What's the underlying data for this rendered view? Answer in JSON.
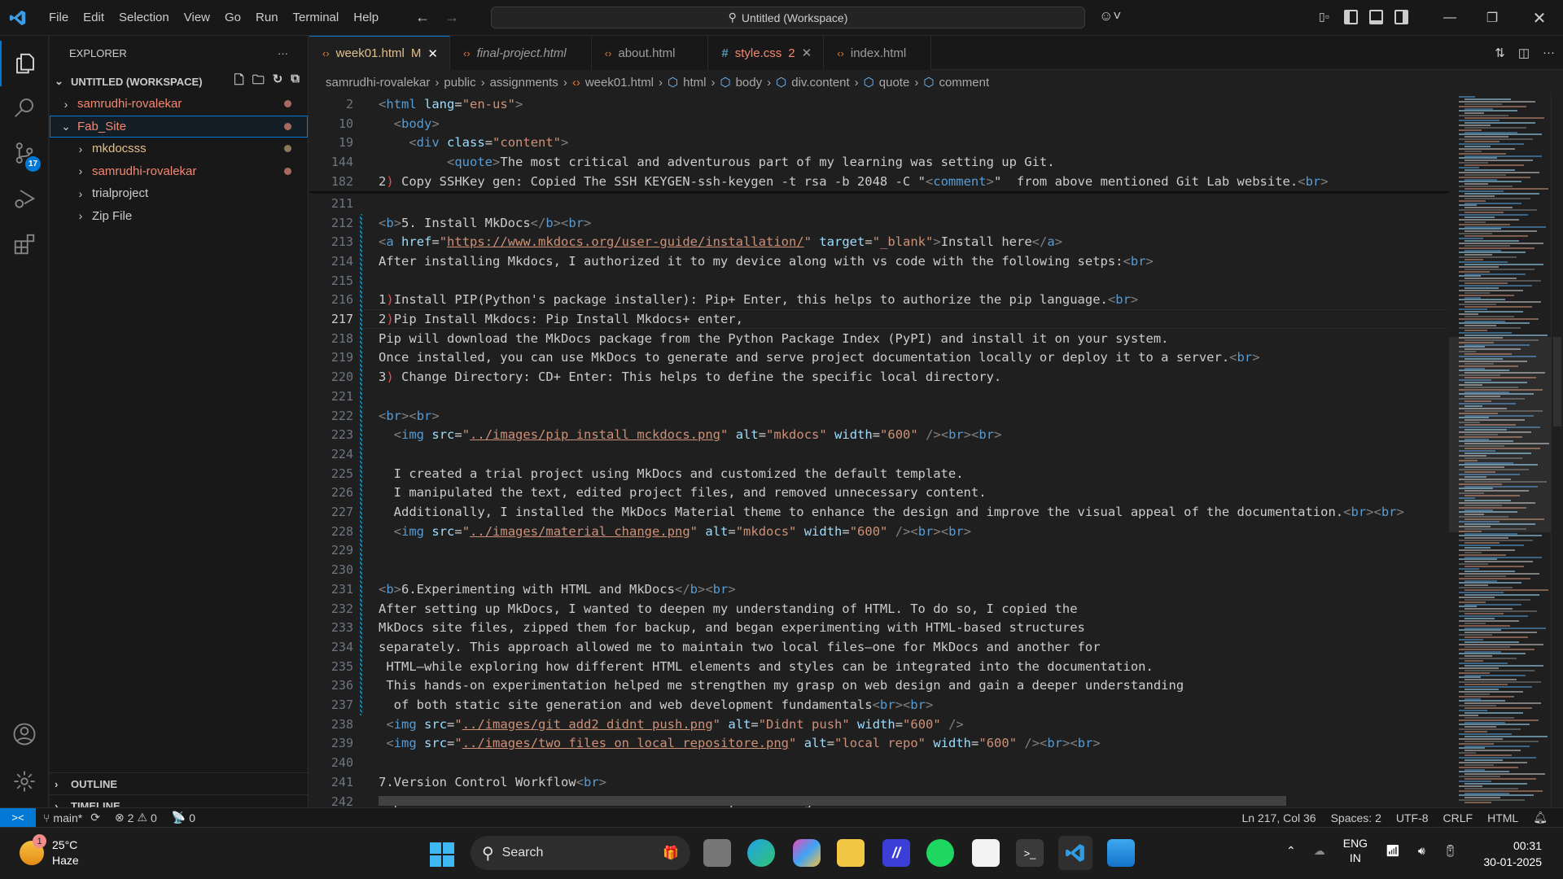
{
  "titlebar": {
    "menu": [
      "File",
      "Edit",
      "Selection",
      "View",
      "Go",
      "Run",
      "Terminal",
      "Help"
    ],
    "command_center": "Untitled (Workspace)",
    "window_controls": [
      "minimize",
      "restore",
      "close"
    ]
  },
  "activity_bar": {
    "items": [
      {
        "name": "explorer",
        "icon": "files-icon",
        "active": true
      },
      {
        "name": "search",
        "icon": "search-icon"
      },
      {
        "name": "source-control",
        "icon": "source-control-icon",
        "badge": "17"
      },
      {
        "name": "run-debug",
        "icon": "debug-icon"
      },
      {
        "name": "extensions",
        "icon": "extensions-icon"
      }
    ],
    "bottom": [
      {
        "name": "accounts",
        "icon": "account-icon"
      },
      {
        "name": "manage",
        "icon": "gear-icon"
      }
    ]
  },
  "sidebar": {
    "title": "EXPLORER",
    "workspace": "UNTITLED (WORKSPACE)",
    "tree": [
      {
        "label": "samrudhi-rovalekar",
        "level": 0,
        "expanded": false,
        "color": "#f48771",
        "dot": "#a8695f"
      },
      {
        "label": "Fab_Site",
        "level": 0,
        "expanded": true,
        "color": "#f48771",
        "dot": "#a8695f",
        "selected": true
      },
      {
        "label": "mkdocsss",
        "level": 1,
        "expanded": false,
        "color": "#e2c08d",
        "dot": "#8a7a5a"
      },
      {
        "label": "samrudhi-rovalekar",
        "level": 1,
        "expanded": false,
        "color": "#f48771",
        "dot": "#a8695f"
      },
      {
        "label": "trialproject",
        "level": 1,
        "expanded": false,
        "color": "#cccccc"
      },
      {
        "label": "Zip File",
        "level": 1,
        "expanded": false,
        "color": "#cccccc"
      }
    ],
    "outline": "OUTLINE",
    "timeline": "TIMELINE"
  },
  "tabs": [
    {
      "label": "week01.html",
      "suffix": "M",
      "icon": "html",
      "active": true,
      "closable": true
    },
    {
      "label": "final-project.html",
      "icon": "html",
      "italic": true
    },
    {
      "label": "about.html",
      "icon": "html"
    },
    {
      "label": "style.css",
      "suffix": "2",
      "icon": "css",
      "closable": true,
      "color": "#f48771"
    },
    {
      "label": "index.html",
      "icon": "html"
    }
  ],
  "breadcrumb": [
    "samrudhi-rovalekar",
    "public",
    "assignments",
    "week01.html",
    "html",
    "body",
    "div.content",
    "quote",
    "comment"
  ],
  "editor": {
    "sticky": [
      {
        "n": "2",
        "html": "<span class='p'>&lt;</span><span class='t'>html</span> <span class='a'>lang</span>=<span class='s'>\"en-us\"</span><span class='p'>&gt;</span>"
      },
      {
        "n": "10",
        "html": "  <span class='p'>&lt;</span><span class='t'>body</span><span class='p'>&gt;</span>"
      },
      {
        "n": "19",
        "html": "    <span class='p'>&lt;</span><span class='t'>div</span> <span class='a'>class</span>=<span class='s'>\"content\"</span><span class='p'>&gt;</span>"
      },
      {
        "n": "144",
        "html": "         <span class='p'>&lt;</span><span class='t'>quote</span><span class='p'>&gt;</span>The most critical and adventurous part of my learning was setting up Git."
      },
      {
        "n": "182",
        "html": "2<span class='r'>)</span> Copy SSHKey gen: Copied The SSH KEYGEN-ssh-keygen -t rsa -b 2048 -C \"<span class='p'>&lt;</span><span class='t'>comment</span><span class='p'>&gt;</span>\"  from above mentioned Git Lab website.<span class='p'>&lt;</span><span class='t'>br</span><span class='p'>&gt;</span>"
      }
    ],
    "lines": [
      {
        "n": "211",
        "html": ""
      },
      {
        "n": "212",
        "html": "<span class='p'>&lt;</span><span class='t'>b</span><span class='p'>&gt;</span>5. Install MkDocs<span class='p'>&lt;/</span><span class='t'>b</span><span class='p'>&gt;&lt;</span><span class='t'>br</span><span class='p'>&gt;</span>"
      },
      {
        "n": "213",
        "html": "<span class='p'>&lt;</span><span class='t'>a</span> <span class='a'>href</span>=<span class='s'>\"</span><span class='u'>https://www.mkdocs.org/user-guide/installation/</span><span class='s'>\"</span> <span class='a'>target</span>=<span class='s'>\"_blank\"</span><span class='p'>&gt;</span>Install here<span class='p'>&lt;/</span><span class='t'>a</span><span class='p'>&gt;</span>"
      },
      {
        "n": "214",
        "html": "After installing Mkdocs, I authorized it to my device along with vs code with the following setps:<span class='p'>&lt;</span><span class='t'>br</span><span class='p'>&gt;</span>"
      },
      {
        "n": "215",
        "html": ""
      },
      {
        "n": "216",
        "html": "1<span class='r'>)</span>Install PIP(Python's package installer): Pip+ Enter, this helps to authorize the pip language.<span class='p'>&lt;</span><span class='t'>br</span><span class='p'>&gt;</span>"
      },
      {
        "n": "217",
        "html": "2<span class='r'>)</span>Pip Install Mkdocs: Pip Install Mkdocs+ enter,",
        "current": true
      },
      {
        "n": "218",
        "html": "Pip will download the MkDocs package from the Python Package Index (PyPI) and install it on your system."
      },
      {
        "n": "219",
        "html": "Once installed, you can use MkDocs to generate and serve project documentation locally or deploy it to a server.<span class='p'>&lt;</span><span class='t'>br</span><span class='p'>&gt;</span>"
      },
      {
        "n": "220",
        "html": "3<span class='r'>)</span> Change Directory: CD+ Enter: This helps to define the specific local directory."
      },
      {
        "n": "221",
        "html": ""
      },
      {
        "n": "222",
        "html": "<span class='p'>&lt;</span><span class='t'>br</span><span class='p'>&gt;&lt;</span><span class='t'>br</span><span class='p'>&gt;</span>"
      },
      {
        "n": "223",
        "html": "  <span class='p'>&lt;</span><span class='t'>img</span> <span class='a'>src</span>=<span class='s'>\"</span><span class='u'>../images/pip install mckdocs.png</span><span class='s'>\"</span> <span class='a'>alt</span>=<span class='s'>\"mkdocs\"</span> <span class='a'>width</span>=<span class='s'>\"600\"</span> <span class='p'>/&gt;&lt;</span><span class='t'>br</span><span class='p'>&gt;&lt;</span><span class='t'>br</span><span class='p'>&gt;</span>"
      },
      {
        "n": "224",
        "html": ""
      },
      {
        "n": "225",
        "html": "  I created a trial project using MkDocs and customized the default template."
      },
      {
        "n": "226",
        "html": "  I manipulated the text, edited project files, and removed unnecessary content."
      },
      {
        "n": "227",
        "html": "  Additionally, I installed the MkDocs Material theme to enhance the design and improve the visual appeal of the documentation.<span class='p'>&lt;</span><span class='t'>br</span><span class='p'>&gt;&lt;</span><span class='t'>br</span><span class='p'>&gt;</span>"
      },
      {
        "n": "228",
        "html": "  <span class='p'>&lt;</span><span class='t'>img</span> <span class='a'>src</span>=<span class='s'>\"</span><span class='u'>../images/material change.png</span><span class='s'>\"</span> <span class='a'>alt</span>=<span class='s'>\"mkdocs\"</span> <span class='a'>width</span>=<span class='s'>\"600\"</span> <span class='p'>/&gt;&lt;</span><span class='t'>br</span><span class='p'>&gt;&lt;</span><span class='t'>br</span><span class='p'>&gt;</span>"
      },
      {
        "n": "229",
        "html": ""
      },
      {
        "n": "230",
        "html": ""
      },
      {
        "n": "231",
        "html": "<span class='p'>&lt;</span><span class='t'>b</span><span class='p'>&gt;</span>6.Experimenting with HTML and MkDocs<span class='p'>&lt;/</span><span class='t'>b</span><span class='p'>&gt;&lt;</span><span class='t'>br</span><span class='p'>&gt;</span>"
      },
      {
        "n": "232",
        "html": "After setting up MkDocs, I wanted to deepen my understanding of HTML. To do so, I copied the"
      },
      {
        "n": "233",
        "html": "MkDocs site files, zipped them for backup, and began experimenting with HTML-based structures"
      },
      {
        "n": "234",
        "html": "separately. This approach allowed me to maintain two local files—one for MkDocs and another for"
      },
      {
        "n": "235",
        "html": " HTML—while exploring how different HTML elements and styles can be integrated into the documentation."
      },
      {
        "n": "236",
        "html": " This hands-on experimentation helped me strengthen my grasp on web design and gain a deeper understanding"
      },
      {
        "n": "237",
        "html": "  of both static site generation and web development fundamentals<span class='p'>&lt;</span><span class='t'>br</span><span class='p'>&gt;&lt;</span><span class='t'>br</span><span class='p'>&gt;</span>"
      },
      {
        "n": "238",
        "html": " <span class='p'>&lt;</span><span class='t'>img</span> <span class='a'>src</span>=<span class='s'>\"</span><span class='u'>../images/git add2 didnt push.png</span><span class='s'>\"</span> <span class='a'>alt</span>=<span class='s'>\"Didnt push\"</span> <span class='a'>width</span>=<span class='s'>\"600\"</span> <span class='p'>/&gt;</span>"
      },
      {
        "n": "239",
        "html": " <span class='p'>&lt;</span><span class='t'>img</span> <span class='a'>src</span>=<span class='s'>\"</span><span class='u'>../images/two files on local repositore.png</span><span class='s'>\"</span> <span class='a'>alt</span>=<span class='s'>\"local repo\"</span> <span class='a'>width</span>=<span class='s'>\"600\"</span> <span class='p'>/&gt;&lt;</span><span class='t'>br</span><span class='p'>&gt;&lt;</span><span class='t'>br</span><span class='p'>&gt;</span>"
      },
      {
        "n": "240",
        "html": ""
      },
      {
        "n": "241",
        "html": "7.Version Control Workflow<span class='p'>&lt;</span><span class='t'>br</span><span class='p'>&gt;</span>"
      },
      {
        "n": "242",
        "html": "I practiced essential version control commands, including:<span class='p'>&lt;</span><span class='t'>br</span><span class='p'>&gt;</span>"
      }
    ]
  },
  "statusbar": {
    "branch": "main*",
    "errors": "2",
    "warnings": "0",
    "ports": "0",
    "cursor": "Ln 217, Col 36",
    "indent": "Spaces: 2",
    "encoding": "UTF-8",
    "eol": "CRLF",
    "language": "HTML"
  },
  "taskbar": {
    "weather_temp": "25°C",
    "weather_desc": "Haze",
    "weather_badge": "1",
    "search_label": "Search",
    "apps": [
      "task-view",
      "edge",
      "copilot",
      "file-explorer",
      "app-icon",
      "spotify",
      "microsoft-store",
      "terminal",
      "vscode",
      "photos"
    ],
    "lang_line1": "ENG",
    "lang_line2": "IN",
    "time": "00:31",
    "date": "30-01-2025"
  }
}
